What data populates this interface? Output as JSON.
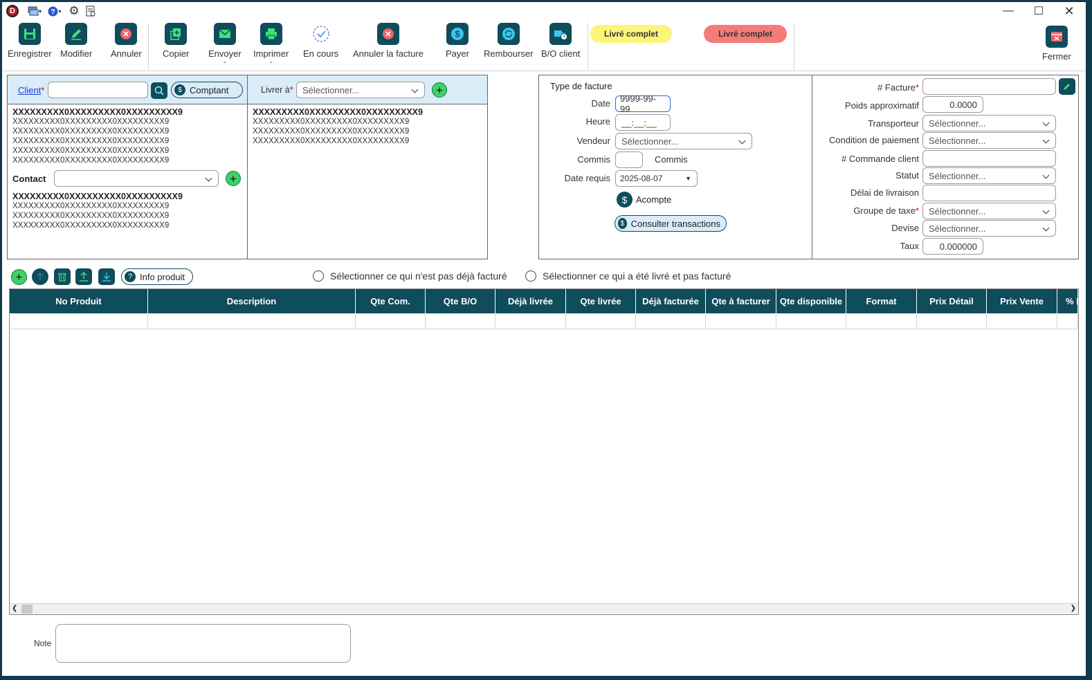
{
  "titlebar": {
    "app_logo": "D"
  },
  "toolbar": {
    "save": "Enregistrer",
    "edit": "Modifier",
    "cancel": "Annuler",
    "copy": "Copier",
    "send": "Envoyer",
    "print": "Imprimer",
    "in_progress": "En cours",
    "cancel_invoice": "Annuler la facture",
    "pay": "Payer",
    "refund": "Rembourser",
    "bo_client": "B/O client",
    "close": "Fermer",
    "status_yellow": "Livré complet",
    "status_red": "Livré complet",
    "status_colors": {
      "yellow": "#fbf57a",
      "red": "#f47c78"
    }
  },
  "client": {
    "label": "Client",
    "value": "",
    "cash_button": "Comptant",
    "line_bold": "XXXXXXXXX0XXXXXXXXX0XXXXXXXXX9",
    "lines": [
      "XXXXXXXXX0XXXXXXXXX0XXXXXXXXX9",
      "XXXXXXXXX0XXXXXXXXX0XXXXXXXXX9",
      "XXXXXXXXX0XXXXXXXXX0XXXXXXXXX9",
      "XXXXXXXXX0XXXXXXXXX0XXXXXXXXX9",
      "XXXXXXXXX0XXXXXXXXX0XXXXXXXXX9"
    ],
    "contact_label": "Contact",
    "contact_value": "",
    "contact_bold": "XXXXXXXXX0XXXXXXXXX0XXXXXXXXX9",
    "contact_lines": [
      "XXXXXXXXX0XXXXXXXXX0XXXXXXXXX9",
      "XXXXXXXXX0XXXXXXXXX0XXXXXXXXX9",
      "XXXXXXXXX0XXXXXXXXX0XXXXXXXXX9"
    ]
  },
  "delivery": {
    "label": "Livrer à",
    "select": "Sélectionner...",
    "line_bold": "XXXXXXXXX0XXXXXXXXX0XXXXXXXXX9",
    "lines": [
      "XXXXXXXXX0XXXXXXXXX0XXXXXXXXX9",
      "XXXXXXXXX0XXXXXXXXX0XXXXXXXXX9",
      "XXXXXXXXX0XXXXXXXXX0XXXXXXXXX9"
    ]
  },
  "invoice": {
    "type_label": "Type de facture",
    "date_label": "Date",
    "date_value": "9999-99-99",
    "time_label": "Heure",
    "time_value": "__:__:__",
    "seller_label": "Vendeur",
    "seller_value": "Sélectionner...",
    "commis_label": "Commis",
    "commis_value": "",
    "commis_suffix": "Commis",
    "required_date_label": "Date requis",
    "required_date_value": "2025-08-07",
    "deposit": "Acompte",
    "transactions": "Consulter transactions"
  },
  "details": {
    "invoice_no_label": "# Facture",
    "invoice_no_value": "",
    "weight_label": "Poids approximatif",
    "weight_value": "0.0000",
    "carrier_label": "Transporteur",
    "carrier_value": "Sélectionner...",
    "payment_label": "Condition de paiement",
    "payment_value": "Sélectionner...",
    "order_label": "# Commande client",
    "order_value": "",
    "status_label": "Statut",
    "status_value": "Sélectionner...",
    "delay_label": "Délai de livraison",
    "delay_value": "",
    "tax_label": "Groupe de taxe",
    "tax_value": "Sélectionner...",
    "currency_label": "Devise",
    "currency_value": "Sélectionner...",
    "rate_label": "Taux",
    "rate_value": "0.000000"
  },
  "grid_toolbar": {
    "info_product": "Info produit",
    "check_not_billed": "Sélectionner ce qui n'est pas déjà facturé",
    "check_delivered": "Sélectionner ce qui a été livré et pas facturé"
  },
  "table": {
    "columns": [
      "No Produit",
      "Description",
      "Qte Com.",
      "Qte B/O",
      "Déjà livrée",
      "Qte livrée",
      "Déjà facturée",
      "Qte à facturer",
      "Qte disponible",
      "Format",
      "Prix Détail",
      "Prix Vente",
      "% E"
    ]
  },
  "note": {
    "label": "Note",
    "value": ""
  }
}
